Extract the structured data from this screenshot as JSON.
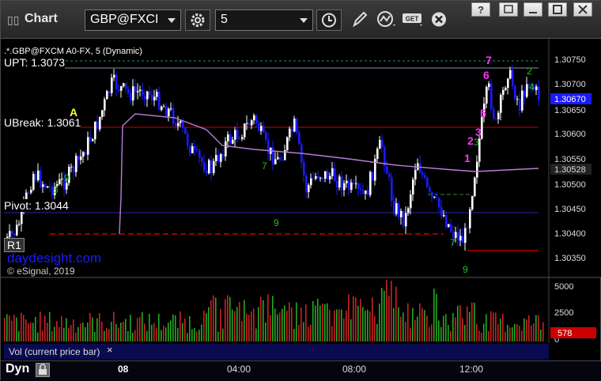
{
  "toolbar": {
    "title": "Chart",
    "symbol": "GBP@FXCI",
    "interval": "5"
  },
  "chart": {
    "header_text": ".*.GBP@FXCM A0-FX, 5 (Dynamic)",
    "labels": {
      "upt": "UPT: 1.3073",
      "ubreak": "UBreak: 1.3061",
      "pivot": "Pivot: 1.3044",
      "r1": "R1",
      "marker_a": "A",
      "watermark": "daydesight.com",
      "copyright": "© eSignal, 2019"
    },
    "price_ticks": [
      "1.30750",
      "1.30700",
      "1.30650",
      "1.30600",
      "1.30550",
      "1.30500",
      "1.30450",
      "1.30400",
      "1.30350"
    ],
    "last_price": "1.30670",
    "vwap_price": "1.30528",
    "volume": {
      "label": "Vol (current price bar)",
      "ticks": [
        "5000",
        "2500",
        "0"
      ],
      "last": "578",
      "close_glyph": "×"
    },
    "time_ticks": [
      "08",
      "04:00",
      "08:00",
      "12:00"
    ],
    "seq_numbers": [
      {
        "text": "7",
        "color": "#ff33ff"
      },
      {
        "text": "6",
        "color": "#ff33ff"
      },
      {
        "text": "5",
        "color": "#ff33ff"
      },
      {
        "text": "3",
        "color": "#ff33ff"
      },
      {
        "text": "2",
        "color": "#ff33ff"
      },
      {
        "text": "1",
        "color": "#ff33ff"
      }
    ]
  },
  "status": {
    "layout_name": "Dyn"
  },
  "colors": {
    "up_bar": "#ffffff",
    "down_bar": "#1a1aff",
    "vwap": "#b87cd8",
    "resistance": "#cc0000",
    "support": "#1c1c8c",
    "upt_line": "#8a8ab0",
    "vol_up": "#22aa22",
    "vol_down": "#cc2222"
  }
}
